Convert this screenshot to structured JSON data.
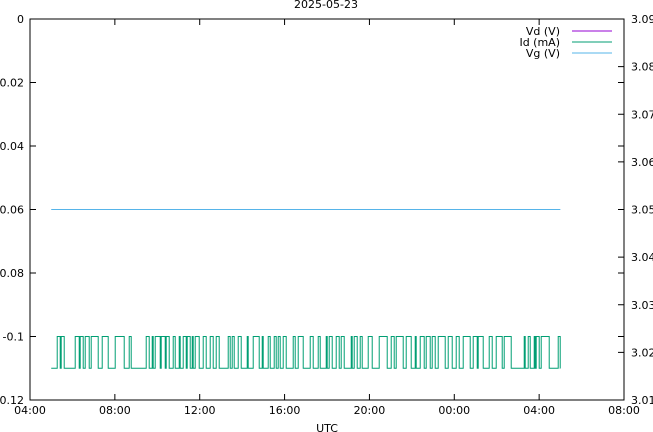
{
  "chart_data": {
    "type": "line",
    "title": "2025-05-23",
    "xlabel": "UTC",
    "ylabel": "",
    "y2label": "",
    "x_ticks": [
      "04:00",
      "08:00",
      "12:00",
      "16:00",
      "20:00",
      "00:00",
      "04:00",
      "08:00"
    ],
    "x_tick_hours": [
      4,
      8,
      12,
      16,
      20,
      24,
      28,
      32
    ],
    "xlim_hours": [
      4,
      32
    ],
    "ylim": [
      -0.12,
      0
    ],
    "y_ticks": [
      "0",
      "-0.02",
      "-0.04",
      "-0.06",
      "-0.08",
      "-0.1",
      "-0.12"
    ],
    "y_tick_values": [
      0,
      -0.02,
      -0.04,
      -0.06,
      -0.08,
      -0.1,
      -0.12
    ],
    "y2lim": [
      3.01,
      3.09
    ],
    "y2_ticks": [
      "3.09",
      "3.08",
      "3.07",
      "3.06",
      "3.05",
      "3.04",
      "3.03",
      "3.02",
      "3.01"
    ],
    "y2_tick_values": [
      3.09,
      3.08,
      3.07,
      3.06,
      3.05,
      3.04,
      3.03,
      3.02,
      3.01
    ],
    "grid": false,
    "legend_position": "top-right",
    "series": [
      {
        "name": "Vd (V)",
        "color": "#9400d3",
        "axis": "y1",
        "x_range_hours": [
          5,
          29
        ],
        "values": []
      },
      {
        "name": "Id (mA)",
        "color": "#009e73",
        "axis": "y1",
        "x_range_hours": [
          5,
          29
        ],
        "style": "noisy-toggle",
        "levels": [
          -0.1,
          -0.11
        ]
      },
      {
        "name": "Vg (V)",
        "color": "#56b4e9",
        "axis": "y1",
        "x_range_hours": [
          5,
          29
        ],
        "constant": -0.06
      }
    ]
  }
}
